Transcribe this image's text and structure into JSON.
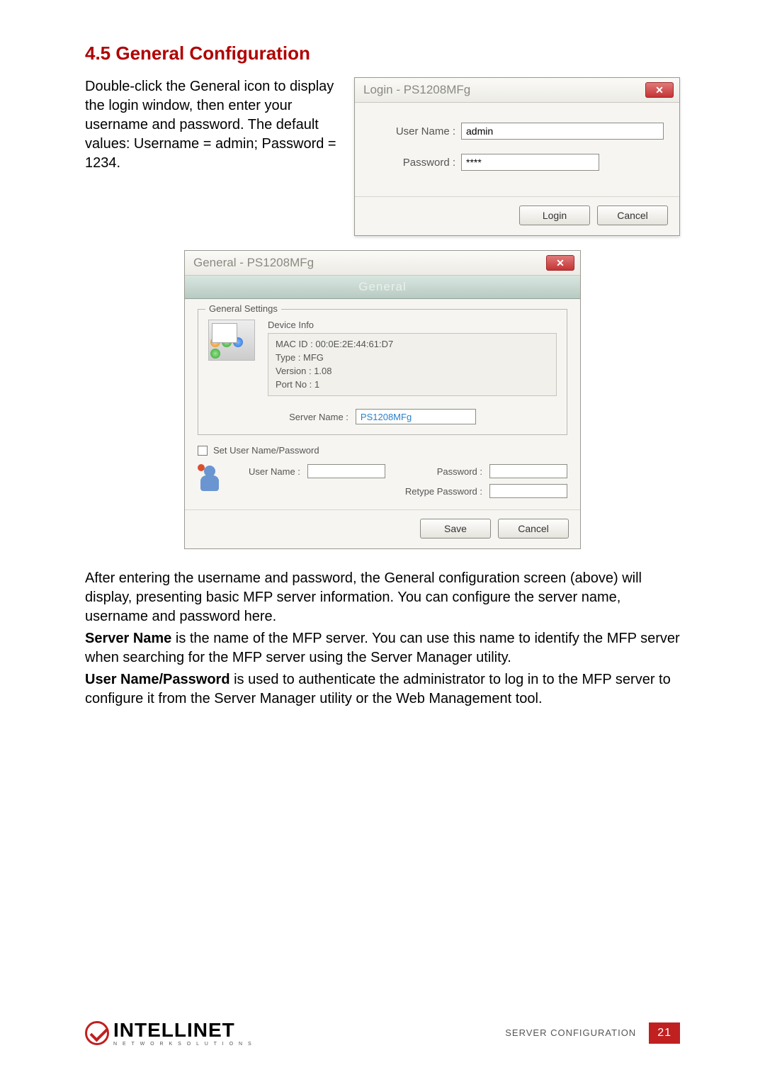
{
  "heading": "4.5  General Configuration",
  "intro": "Double-click the General icon to display the login window, then enter your username and password. The default values: Username = admin; Password = 1234.",
  "login_dialog": {
    "title": "Login - PS1208MFg",
    "username_label": "User Name :",
    "username_value": "admin",
    "password_label": "Password :",
    "password_value": "****",
    "login_btn": "Login",
    "cancel_btn": "Cancel"
  },
  "general_dialog": {
    "title": "General - PS1208MFg",
    "tab_label": "General",
    "settings_legend": "General Settings",
    "device_info_legend": "Device Info",
    "mac_line": "MAC ID : 00:0E:2E:44:61:D7",
    "type_line": "Type : MFG",
    "version_line": "Version : 1.08",
    "port_line": "Port No : 1",
    "server_name_label": "Server Name :",
    "server_name_value": "PS1208MFg",
    "set_cred_label": "Set User Name/Password",
    "un_label": "User Name :",
    "pw_label": "Password :",
    "rpw_label": "Retype Password :",
    "save_btn": "Save",
    "cancel_btn": "Cancel"
  },
  "body_p1": "After entering the username and password, the General configuration screen (above) will display, presenting basic MFP server information. You can configure the server name, username and password here.",
  "body_p2a": "Server Name",
  "body_p2b": " is the name of the MFP server. You can use this name to identify the MFP server when searching for the MFP server using the Server Manager utility.",
  "body_p3a": "User Name/Password",
  "body_p3b": " is used to authenticate the administrator to log in to the MFP server to configure it from the Server Manager utility or the Web Management tool.",
  "footer": {
    "brand_big": "INTELLINET",
    "brand_small": "N E T W O R K   S O L U T I O N S",
    "section_label": "SERVER CONFIGURATION",
    "page": "21"
  }
}
